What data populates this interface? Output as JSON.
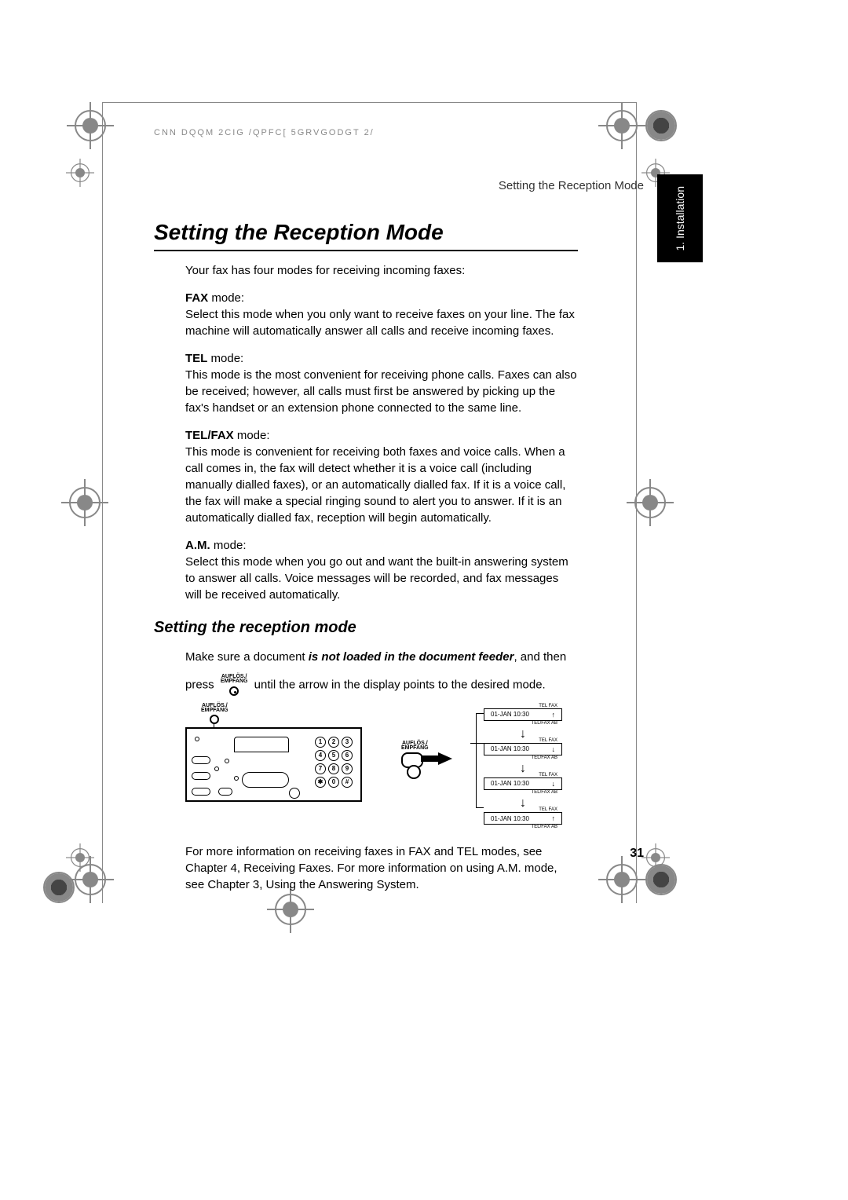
{
  "header": {
    "code": "CNN DQQM 2CIG /QPFC[ 5GRVGODGT 2/"
  },
  "runningHeader": "Setting the Reception Mode",
  "sideTab": "1. Installation",
  "mainHeading": "Setting the Reception Mode",
  "intro": "Your fax has four modes for receiving incoming faxes:",
  "modes": {
    "fax": {
      "label": "FAX",
      "suffix": " mode:",
      "desc": "Select this mode when you only want to receive faxes on your line. The fax machine will automatically answer all calls and receive incoming faxes."
    },
    "tel": {
      "label": "TEL",
      "suffix": " mode:",
      "desc": "This mode is the most convenient for receiving phone calls. Faxes can also be received; however, all calls must first be answered by picking up the fax's handset or an extension phone connected to the same line."
    },
    "telfax": {
      "label": "TEL/FAX",
      "suffix": " mode:",
      "desc": "This mode is convenient for receiving both faxes and voice calls. When a call comes in, the fax will detect whether it is a voice call (including manually dialled faxes), or an automatically dialled fax. If it is a voice call, the fax will make a special ringing sound to alert you to answer. If it is an automatically dialled fax, reception will begin automatically."
    },
    "am": {
      "label": "A.M.",
      "suffix": " mode:",
      "desc": "Select this mode when you go out and want the built-in answering system to answer all calls. Voice messages will be recorded, and fax messages will be received automatically."
    }
  },
  "subHeading": "Setting the reception mode",
  "instruction": {
    "line1_a": "Make sure a document ",
    "line1_emphasis": "is not loaded in the document feeder",
    "line1_b": ", and then",
    "line2_a": "press",
    "line2_b": "until the arrow in the display points to the desired mode."
  },
  "buttonLabel": {
    "line1": "AUFLÖS./",
    "line2": "EMPFANG"
  },
  "keypad": [
    "1",
    "2",
    "3",
    "4",
    "5",
    "6",
    "7",
    "8",
    "9",
    "✱",
    "0",
    "#"
  ],
  "displays": [
    {
      "topLabel": "TEL FAX",
      "date": "01-JAN 10:30",
      "arrow": "↑",
      "bottomLabel": "TEL/FAX AB"
    },
    {
      "topLabel": "TEL FAX",
      "date": "01-JAN 10:30",
      "arrow": "↓",
      "bottomLabel": "TEL/FAX AB"
    },
    {
      "topLabel": "TEL FAX",
      "date": "01-JAN 10:30",
      "arrow": "↓",
      "bottomLabel": "TEL/FAX AB"
    },
    {
      "topLabel": "TEL FAX",
      "date": "01-JAN 10:30",
      "arrow": "↑",
      "bottomLabel": "TEL/FAX AB"
    }
  ],
  "footerBody": "For more information on receiving faxes in FAX and TEL modes, see Chapter 4, Receiving Faxes. For more information on using A.M. mode, see Chapter 3, Using the Answering System.",
  "pageNumber": "31"
}
